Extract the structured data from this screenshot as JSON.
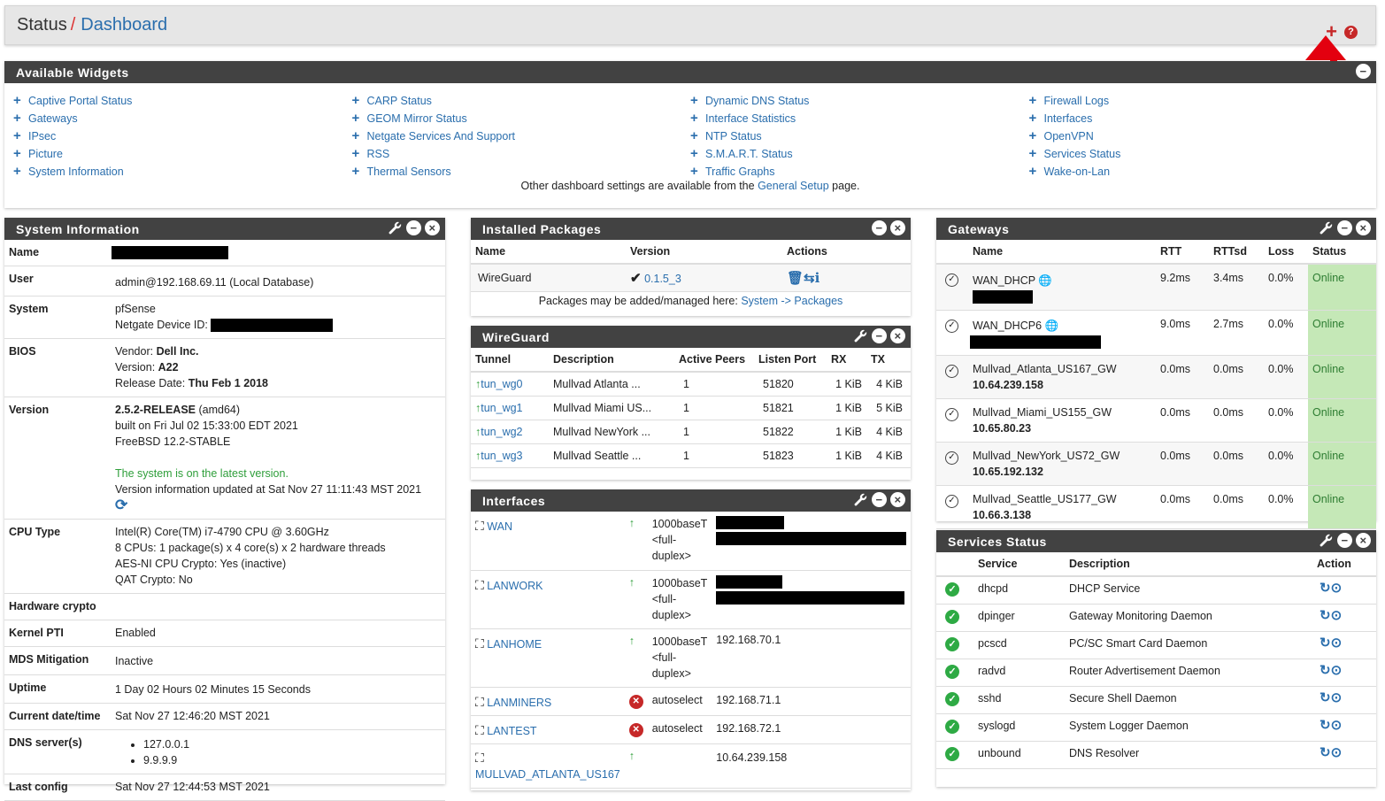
{
  "breadcrumb": {
    "status": "Status",
    "sep": "/",
    "dashboard": "Dashboard"
  },
  "header_icons": [
    "plus-icon",
    "help-icon"
  ],
  "available_widgets": {
    "title": "Available Widgets",
    "columns": [
      [
        "Captive Portal Status",
        "Gateways",
        "IPsec",
        "Picture",
        "System Information"
      ],
      [
        "CARP Status",
        "GEOM Mirror Status",
        "Netgate Services And Support",
        "RSS",
        "Thermal Sensors"
      ],
      [
        "Dynamic DNS Status",
        "Interface Statistics",
        "NTP Status",
        "S.M.A.R.T. Status",
        "Traffic Graphs"
      ],
      [
        "Firewall Logs",
        "Interfaces",
        "OpenVPN",
        "Services Status",
        "Wake-on-Lan"
      ]
    ],
    "footer_pre": "Other dashboard settings are available from the",
    "footer_link": "General Setup",
    "footer_post": "page."
  },
  "system_info": {
    "title": "System Information",
    "name_k": "Name",
    "user_k": "User",
    "user_v": "admin@192.168.69.11 (Local Database)",
    "system_k": "System",
    "system_v1": "pfSense",
    "system_v2": "Netgate Device ID:",
    "bios_k": "BIOS",
    "bios_vendor": "Vendor:",
    "bios_vendor_v": "Dell Inc.",
    "bios_version": "Version:",
    "bios_version_v": "A22",
    "bios_date": "Release Date:",
    "bios_date_v": "Thu Feb 1 2018",
    "version_k": "Version",
    "version_v": "2.5.2-RELEASE",
    "version_arch": "(amd64)",
    "built": "built on Fri Jul 02 15:33:00 EDT 2021",
    "freebsd": "FreeBSD 12.2-STABLE",
    "latest": "The system is on the latest version.",
    "updated": "Version information updated at Sat Nov 27 11:11:43 MST 2021",
    "cpu_k": "CPU Type",
    "cpu1": "Intel(R) Core(TM) i7-4790 CPU @ 3.60GHz",
    "cpu2": "8 CPUs: 1 package(s) x 4 core(s) x 2 hardware threads",
    "cpu3": "AES-NI CPU Crypto: Yes (inactive)",
    "cpu4": "QAT Crypto: No",
    "hwc_k": "Hardware crypto",
    "pti_k": "Kernel PTI",
    "pti_v": "Enabled",
    "mds_k": "MDS Mitigation",
    "mds_v": "Inactive",
    "uptime_k": "Uptime",
    "uptime_v": "1 Day 02 Hours 02 Minutes 15 Seconds",
    "date_k": "Current date/time",
    "date_v": "Sat Nov 27 12:46:20 MST 2021",
    "dns_k": "DNS server(s)",
    "dns": [
      "127.0.0.1",
      "9.9.9.9"
    ],
    "last_k": "Last config",
    "last_v": "Sat Nov 27 12:44:53 MST 2021"
  },
  "packages": {
    "title": "Installed Packages",
    "h": [
      "Name",
      "Version",
      "Actions"
    ],
    "name": "WireGuard",
    "version": "0.1.5_3",
    "footer_pre": "Packages may be added/managed here:",
    "footer_link": "System -> Packages"
  },
  "wireguard": {
    "title": "WireGuard",
    "h": [
      "Tunnel",
      "Description",
      "Active Peers",
      "Listen Port",
      "RX",
      "TX"
    ],
    "rows": [
      {
        "t": "tun_wg0",
        "d": "Mullvad Atlanta ...",
        "p": "1",
        "l": "51820",
        "rx": "1 KiB",
        "tx": "4 KiB"
      },
      {
        "t": "tun_wg1",
        "d": "Mullvad Miami US...",
        "p": "1",
        "l": "51821",
        "rx": "1 KiB",
        "tx": "5 KiB"
      },
      {
        "t": "tun_wg2",
        "d": "Mullvad NewYork ...",
        "p": "1",
        "l": "51822",
        "rx": "1 KiB",
        "tx": "4 KiB"
      },
      {
        "t": "tun_wg3",
        "d": "Mullvad Seattle ...",
        "p": "1",
        "l": "51823",
        "rx": "1 KiB",
        "tx": "4 KiB"
      }
    ]
  },
  "interfaces": {
    "title": "Interfaces",
    "rows": [
      {
        "n": "WAN",
        "s": "up",
        "m1": "1000baseT",
        "m2": "<full-",
        "m3": "duplex>",
        "ip": ""
      },
      {
        "n": "LANWORK",
        "s": "up",
        "m1": "1000baseT",
        "m2": "<full-",
        "m3": "duplex>",
        "ip": ""
      },
      {
        "n": "LANHOME",
        "s": "up",
        "m1": "1000baseT",
        "m2": "<full-",
        "m3": "duplex>",
        "ip": "192.168.70.1"
      },
      {
        "n": "LANMINERS",
        "s": "down",
        "m1": "autoselect",
        "m2": "",
        "m3": "",
        "ip": "192.168.71.1"
      },
      {
        "n": "LANTEST",
        "s": "down",
        "m1": "autoselect",
        "m2": "",
        "m3": "",
        "ip": "192.168.72.1"
      },
      {
        "n": "MULLVAD_ATLANTA_US167",
        "s": "up",
        "m1": "",
        "m2": "",
        "m3": "",
        "ip": "10.64.239.158"
      }
    ]
  },
  "gateways": {
    "title": "Gateways",
    "h": [
      "Name",
      "RTT",
      "RTTsd",
      "Loss",
      "Status"
    ],
    "rows": [
      {
        "n": "WAN_DHCP",
        "ip": "",
        "rtt": "9.2ms",
        "sd": "3.4ms",
        "loss": "0.0%",
        "st": "Online"
      },
      {
        "n": "WAN_DHCP6",
        "ip": "",
        "rtt": "9.0ms",
        "sd": "2.7ms",
        "loss": "0.0%",
        "st": "Online"
      },
      {
        "n": "Mullvad_Atlanta_US167_GW",
        "ip": "10.64.239.158",
        "rtt": "0.0ms",
        "sd": "0.0ms",
        "loss": "0.0%",
        "st": "Online"
      },
      {
        "n": "Mullvad_Miami_US155_GW",
        "ip": "10.65.80.23",
        "rtt": "0.0ms",
        "sd": "0.0ms",
        "loss": "0.0%",
        "st": "Online"
      },
      {
        "n": "Mullvad_NewYork_US72_GW",
        "ip": "10.65.192.132",
        "rtt": "0.0ms",
        "sd": "0.0ms",
        "loss": "0.0%",
        "st": "Online"
      },
      {
        "n": "Mullvad_Seattle_US177_GW",
        "ip": "10.66.3.138",
        "rtt": "0.0ms",
        "sd": "0.0ms",
        "loss": "0.0%",
        "st": "Online"
      }
    ]
  },
  "services": {
    "title": "Services Status",
    "h": [
      "Service",
      "Description",
      "Action"
    ],
    "rows": [
      {
        "s": "dhcpd",
        "d": "DHCP Service"
      },
      {
        "s": "dpinger",
        "d": "Gateway Monitoring Daemon"
      },
      {
        "s": "pcscd",
        "d": "PC/SC Smart Card Daemon"
      },
      {
        "s": "radvd",
        "d": "Router Advertisement Daemon"
      },
      {
        "s": "sshd",
        "d": "Secure Shell Daemon"
      },
      {
        "s": "syslogd",
        "d": "System Logger Daemon"
      },
      {
        "s": "unbound",
        "d": "DNS Resolver"
      }
    ]
  },
  "colors": {
    "header": "#424242",
    "link": "#2a6ead",
    "online": "#c5e8b7",
    "arrow": "#e3000f"
  }
}
